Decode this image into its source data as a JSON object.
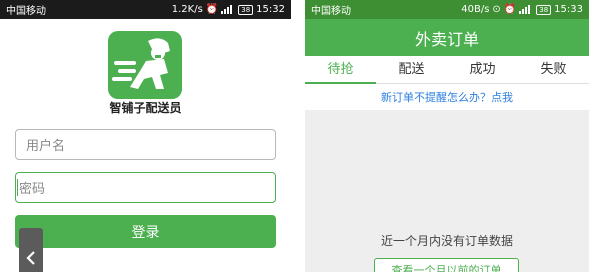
{
  "left": {
    "status": {
      "carrier": "中国移动",
      "speed": "1.2K/s",
      "battery": "38",
      "time": "15:32"
    },
    "app_name": "智铺子配送员",
    "username_placeholder": "用户名",
    "password_placeholder": "密码",
    "login_label": "登录",
    "back_icon": "chevron-left-icon"
  },
  "right": {
    "status": {
      "carrier": "中国移动",
      "speed": "40B/s",
      "battery": "38",
      "time": "15:33"
    },
    "title": "外卖订单",
    "tabs": [
      {
        "label": "待抢",
        "active": true
      },
      {
        "label": "配送",
        "active": false
      },
      {
        "label": "成功",
        "active": false
      },
      {
        "label": "失败",
        "active": false
      }
    ],
    "notice_link": "新订单不提醒怎么办？点我",
    "empty_text": "近一个月内没有订单数据",
    "older_orders_label": "查看一个月以前的订单"
  },
  "colors": {
    "accent": "#4caf50",
    "link": "#2d7fe0",
    "statusbar_dark": "#1b1b1b"
  }
}
